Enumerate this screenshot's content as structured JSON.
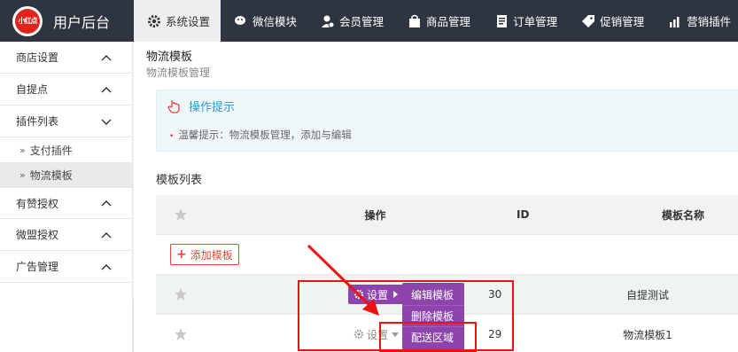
{
  "brand": {
    "logo_text": "小红点",
    "title": "用户后台"
  },
  "topnav": [
    {
      "label": "系统设置",
      "icon": "gear-icon",
      "active": true
    },
    {
      "label": "微信模块",
      "icon": "wechat-icon"
    },
    {
      "label": "会员管理",
      "icon": "member-icon"
    },
    {
      "label": "商品管理",
      "icon": "bag-icon"
    },
    {
      "label": "订单管理",
      "icon": "order-icon"
    },
    {
      "label": "促销管理",
      "icon": "tag-icon"
    },
    {
      "label": "营销插件",
      "icon": "chart-icon"
    }
  ],
  "sidebar": {
    "items": [
      {
        "label": "商店设置",
        "expanded": false
      },
      {
        "label": "自提点",
        "expanded": false
      },
      {
        "label": "插件列表",
        "expanded": true
      },
      {
        "label": "有赞授权",
        "expanded": false
      },
      {
        "label": "微盟授权",
        "expanded": false
      },
      {
        "label": "广告管理",
        "expanded": false
      }
    ],
    "subitems": [
      {
        "label": "支付插件"
      },
      {
        "label": "物流模板",
        "active": true
      }
    ]
  },
  "page": {
    "title": "物流模板",
    "subtitle": "物流模板管理",
    "hint_title": "操作提示",
    "hint_text": "温馨提示：物流模板管理，添加与编辑",
    "list_title": "模板列表"
  },
  "table": {
    "headers": {
      "action": "操作",
      "id": "ID",
      "name": "模板名称"
    },
    "add_label": "添加模板",
    "rows": [
      {
        "set_label": "设置",
        "id": "30",
        "name": "自提测试",
        "active": true
      },
      {
        "set_label": "设置",
        "id": "29",
        "name": "物流模板1",
        "active": false
      }
    ],
    "dropdown": [
      "编辑模板",
      "删除模板",
      "配送区域"
    ]
  },
  "colors": {
    "topbar": "#2f3540",
    "accent_purple": "#8e44ad",
    "annotation_red": "#e11111",
    "hint_blue": "#2c9bd6"
  }
}
